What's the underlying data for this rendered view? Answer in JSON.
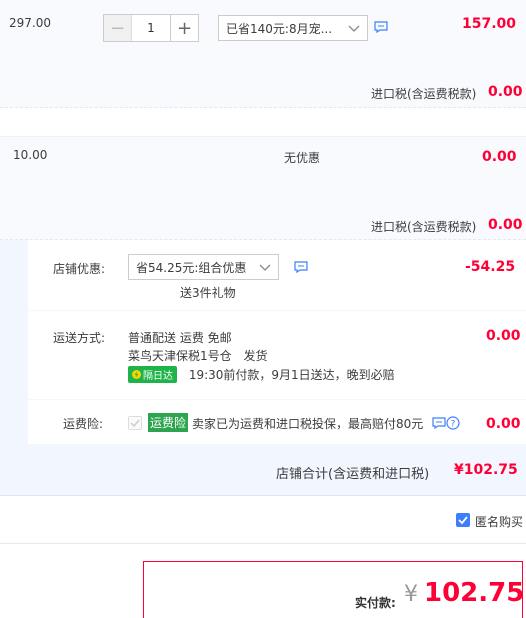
{
  "item1": {
    "unit_price": "297.00",
    "quantity": "1",
    "promo_select": "已省140元:8月宠...",
    "subtotal": "157.00",
    "tax_label": "进口税(含运费税款)",
    "tax_value": "0.00"
  },
  "item2": {
    "unit_price": "10.00",
    "promo_text": "无优惠",
    "subtotal": "0.00",
    "tax_label": "进口税(含运费税款)",
    "tax_value": "0.00"
  },
  "shop": {
    "discount_label": "店铺优惠:",
    "discount_select": "省54.25元:组合优惠",
    "discount_gift": "送3件礼物",
    "discount_value": "-54.25",
    "shipping_label": "运送方式:",
    "shipping_line1": "普通配送 运费 免邮",
    "shipping_line2": "菜鸟天津保税1号仓",
    "shipping_line2_suffix": "发货",
    "shipping_badge": "隔日达",
    "shipping_line3": "19:30前付款，9月1日送达，晚到必赔",
    "shipping_value": "0.00",
    "insurance_label": "运费险:",
    "insurance_badge": "运费险",
    "insurance_text": "卖家已为运费和进口税投保，最高赔付80元",
    "insurance_value": "0.00",
    "total_label": "店铺合计(含运费和进口税)",
    "total_value": "¥102.75"
  },
  "anonymous": {
    "label": "匿名购买",
    "checked": true
  },
  "footer": {
    "pay_label": "实付款:",
    "currency": "¥",
    "pay_value": "102.75"
  },
  "colors": {
    "accent": "#ff0036",
    "green": "#1fb44a",
    "link": "#3d7eff"
  }
}
